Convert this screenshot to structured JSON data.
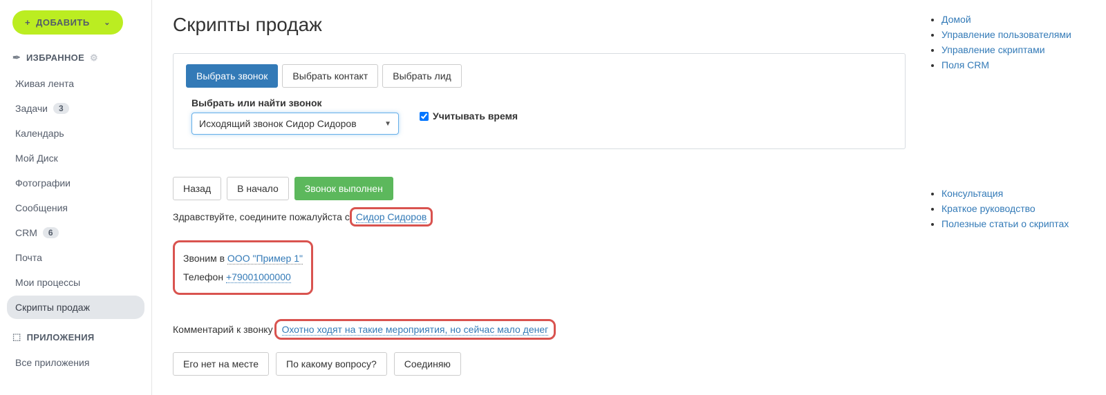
{
  "addButton": {
    "label": "ДОБАВИТЬ"
  },
  "favorites": {
    "title": "ИЗБРАННОЕ",
    "items": [
      {
        "label": "Живая лента"
      },
      {
        "label": "Задачи",
        "badge": "3"
      },
      {
        "label": "Календарь"
      },
      {
        "label": "Мой Диск"
      },
      {
        "label": "Фотографии"
      },
      {
        "label": "Сообщения"
      },
      {
        "label": "CRM",
        "badge": "6"
      },
      {
        "label": "Почта"
      },
      {
        "label": "Мои процессы"
      },
      {
        "label": "Скрипты продаж",
        "active": true
      }
    ]
  },
  "apps": {
    "title": "ПРИЛОЖЕНИЯ",
    "items": [
      {
        "label": "Все приложения"
      }
    ]
  },
  "page": {
    "title": "Скрипты продаж"
  },
  "tabs": {
    "call": "Выбрать звонок",
    "contact": "Выбрать контакт",
    "lead": "Выбрать лид"
  },
  "selectCall": {
    "label": "Выбрать или найти звонок",
    "value": "Исходящий звонок Сидор Сидоров"
  },
  "considerTime": {
    "label": "Учитывать время"
  },
  "actions": {
    "back": "Назад",
    "start": "В начало",
    "done": "Звонок выполнен"
  },
  "greeting": {
    "prefix": "Здравствуйте, соедините пожалуйста с ",
    "name": "Сидор Сидоров"
  },
  "callInfo": {
    "callingPrefix": "Звоним в ",
    "company": "ООО \"Пример 1\"",
    "phoneLabel": "Телефон ",
    "phone": "+79001000000"
  },
  "comment": {
    "prefix": "Комментарий к звонку ",
    "text": "Охотно ходят на такие мероприятия, но сейчас мало денег"
  },
  "responses": {
    "absent": "Его нет на месте",
    "question": "По какому вопросу?",
    "connecting": "Соединяю"
  },
  "rightLinks1": [
    "Домой",
    "Управление пользователями",
    "Управление скриптами",
    "Поля CRM"
  ],
  "rightLinks2": [
    "Консультация",
    "Краткое руководство",
    "Полезные статьи о скриптах"
  ]
}
